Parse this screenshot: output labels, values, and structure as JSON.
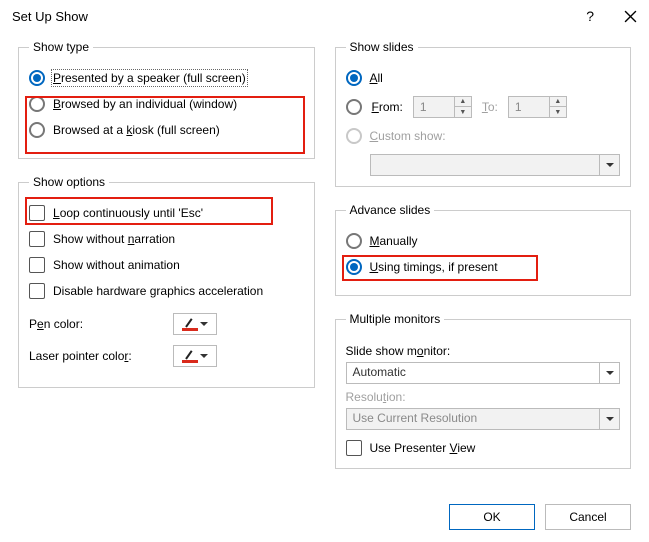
{
  "title": "Set Up Show",
  "groups": {
    "show_type": {
      "legend": "Show type",
      "opt_speaker": "Presented by a speaker (full screen)",
      "opt_individual": "Browsed by an individual (window)",
      "opt_kiosk": "Browsed at a kiosk (full screen)"
    },
    "show_options": {
      "legend": "Show options",
      "loop": "Loop continuously until 'Esc'",
      "no_narration": "Show without narration",
      "no_animation": "Show without animation",
      "disable_hw": "Disable hardware graphics acceleration",
      "pen_color": "Pen color:",
      "laser_color": "Laser pointer color:"
    },
    "show_slides": {
      "legend": "Show slides",
      "all": "All",
      "from": "From:",
      "to": "To:",
      "from_val": "1",
      "to_val": "1",
      "custom": "Custom show:"
    },
    "advance": {
      "legend": "Advance slides",
      "manually": "Manually",
      "timings": "Using timings, if present"
    },
    "monitors": {
      "legend": "Multiple monitors",
      "monitor_label": "Slide show monitor:",
      "monitor_val": "Automatic",
      "res_label": "Resolution:",
      "res_val": "Use Current Resolution",
      "presenter": "Use Presenter View"
    }
  },
  "buttons": {
    "ok": "OK",
    "cancel": "Cancel"
  }
}
